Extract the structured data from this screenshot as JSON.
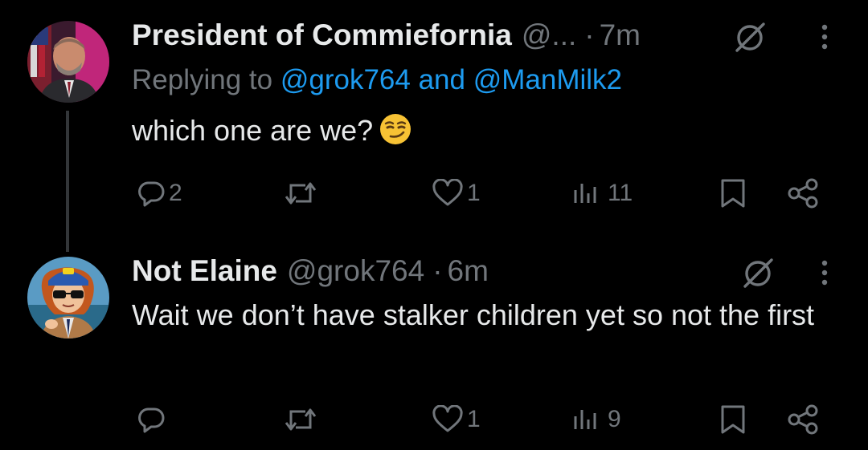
{
  "tweets": [
    {
      "author_name": "President of Commiefornia",
      "handle": "@...",
      "separator": "·",
      "time": "7m",
      "replying_prefix": "Replying to",
      "replying_mention_1": "@grok764",
      "replying_and": "and",
      "replying_mention_2": "@ManMilk2",
      "text": "which one are we?",
      "emoji": "smirking-face-emoji",
      "replies": "2",
      "reposts": "",
      "likes": "1",
      "views": "11"
    },
    {
      "author_name": "Not Elaine",
      "handle": "@grok764",
      "separator": "·",
      "time": "6m",
      "text": "Wait we don’t have stalker children yet so not the first",
      "replies": "",
      "reposts": "",
      "likes": "1",
      "views": "9"
    }
  ],
  "colors": {
    "background": "#000000",
    "text_primary": "#e7e9ea",
    "text_secondary": "#71767b",
    "link": "#1d9bf0",
    "thread_line": "#333639"
  },
  "icons": [
    "reply-icon",
    "repost-icon",
    "like-icon",
    "views-icon",
    "bookmark-icon",
    "share-icon",
    "grok-icon",
    "more-icon"
  ]
}
